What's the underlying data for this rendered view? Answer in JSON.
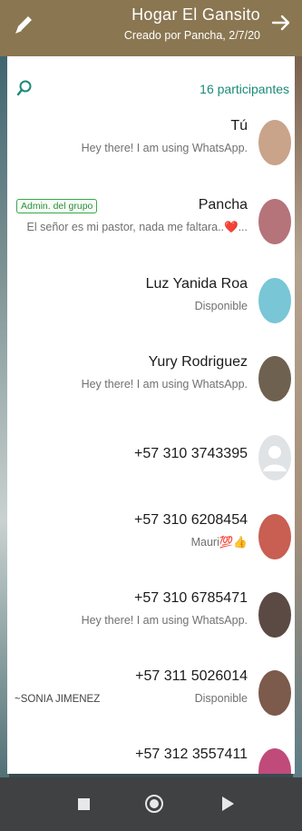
{
  "header": {
    "title": "Hogar El Gansito",
    "subtitle": "Creado por Pancha, 2/7/20"
  },
  "participants": {
    "count_label": "16 participantes",
    "list": [
      {
        "name": "Tú",
        "status": "Hey there! I am using WhatsApp.",
        "badge": "",
        "extra": "",
        "avatar": "#c9a38a"
      },
      {
        "name": "Pancha",
        "status": "El señor es mi pastor, nada me faltara..❤️...",
        "badge": "Admin. del grupo",
        "extra": "",
        "avatar": "#b5737a"
      },
      {
        "name": "Luz Yanida Roa",
        "status": "Disponible",
        "badge": "",
        "extra": "",
        "avatar": "#79c6d6"
      },
      {
        "name": "Yury Rodriguez",
        "status": "Hey there! I am using WhatsApp.",
        "badge": "",
        "extra": "",
        "avatar": "#6e6150"
      },
      {
        "name": "+57 310 3743395",
        "status": "",
        "badge": "",
        "extra": "",
        "avatar": "#dfe3e5"
      },
      {
        "name": "+57 310 6208454",
        "status": "Mauri💯👍",
        "badge": "",
        "extra": "",
        "avatar": "#c95e52"
      },
      {
        "name": "+57 310 6785471",
        "status": "Hey there! I am using WhatsApp.",
        "badge": "",
        "extra": "",
        "avatar": "#5b4a44"
      },
      {
        "name": "+57 311 5026014",
        "status": "Disponible",
        "badge": "",
        "extra": "~SONIA JIMENEZ",
        "avatar": "#7c5a4c"
      },
      {
        "name": "+57 312 3557411",
        "status": "",
        "badge": "",
        "extra": "",
        "avatar": "#c04b7a"
      }
    ]
  },
  "colors": {
    "header": "#8a7651",
    "accent": "#1a8b7a",
    "badge": "#2e8b3e"
  },
  "icons": {
    "edit": "pencil-icon",
    "back": "arrow-right-icon",
    "search": "search-icon"
  },
  "navbar": {
    "icons": [
      "stop-square-icon",
      "home-circle-icon",
      "play-triangle-icon"
    ]
  }
}
